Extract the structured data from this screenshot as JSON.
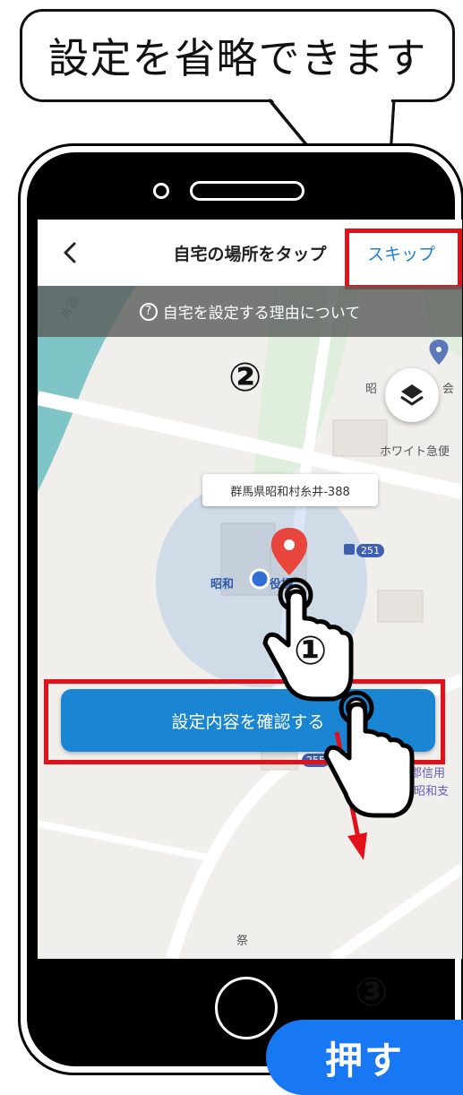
{
  "callout": {
    "text": "設定を省略できます"
  },
  "screen": {
    "title": "自宅の場所をタップ",
    "skip_label": "スキップ",
    "info_text": "自宅を設定する理由について",
    "info_icon": "?"
  },
  "map": {
    "address": "群馬県昭和村糸井-388",
    "labels": {
      "river": "片品",
      "building_top": "昭",
      "building_top2": "会",
      "white_express": "ホワイト急便",
      "office": "昭和",
      "office2": "役場",
      "bank": "利根郡信用",
      "bank2": "金庫 昭和支",
      "bottom": "祭"
    },
    "road_badges": {
      "r1": "251",
      "r2": "255"
    }
  },
  "confirm_label": "設定内容を確認する",
  "steps": {
    "step1": "①",
    "step2": "②",
    "step3": "③"
  },
  "press_label": "押す",
  "colors": {
    "highlight": "#e3101a",
    "accent": "#1a86d3",
    "press": "#1877f2"
  }
}
